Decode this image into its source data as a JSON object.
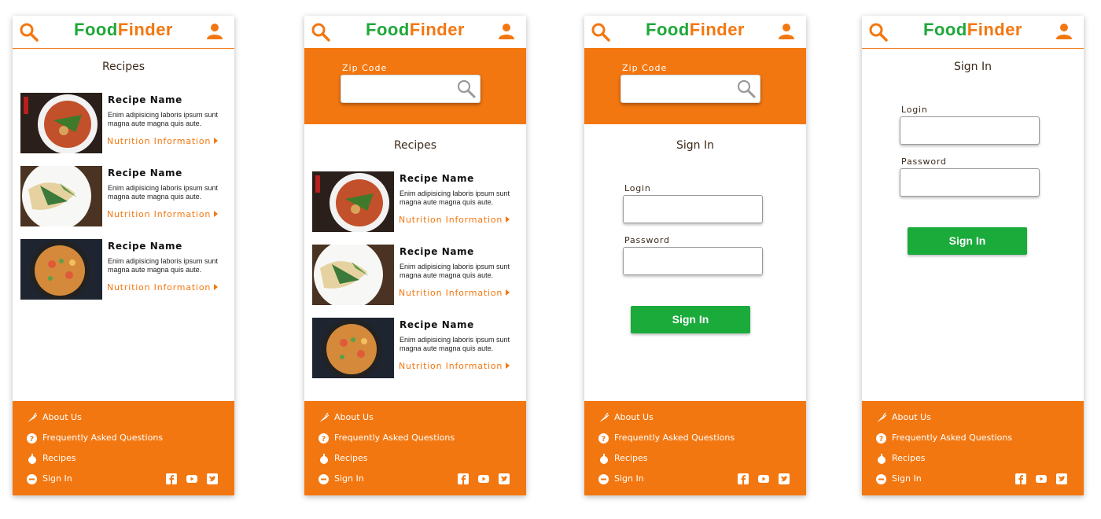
{
  "brand": {
    "food": "Food",
    "finder": "Finder",
    "accent": "#f37710",
    "green": "#1fa83a"
  },
  "icons": {
    "search": "search-icon",
    "user": "user-icon",
    "carrot": "carrot-icon"
  },
  "zip": {
    "label": "Zip Code",
    "value": ""
  },
  "recipes": {
    "title": "Recipes",
    "items": [
      {
        "name": "Recipe Name",
        "desc": "Enim adipisicing laboris ipsum sunt magna aute magna quis aute.",
        "link": "Nutrition Information",
        "image": "curry-soup-photo"
      },
      {
        "name": "Recipe Name",
        "desc": "Enim adipisicing laboris ipsum sunt magna aute magna quis aute.",
        "link": "Nutrition Information",
        "image": "pasta-photo"
      },
      {
        "name": "Recipe Name",
        "desc": "Enim adipisicing laboris ipsum sunt magna aute magna quis aute.",
        "link": "Nutrition Information",
        "image": "paella-photo"
      }
    ]
  },
  "signin": {
    "title": "Sign In",
    "login_label": "Login",
    "password_label": "Password",
    "button": "Sign In",
    "button_color": "#1aab3b"
  },
  "footer": {
    "items": [
      {
        "label": "About Us",
        "icon": "carrot-icon"
      },
      {
        "label": "Frequently Asked Questions",
        "icon": "question-icon"
      },
      {
        "label": "Recipes",
        "icon": "apple-icon"
      },
      {
        "label": "Sign In",
        "icon": "signin-icon"
      }
    ],
    "social": [
      "facebook-icon",
      "youtube-icon",
      "twitter-icon"
    ]
  }
}
